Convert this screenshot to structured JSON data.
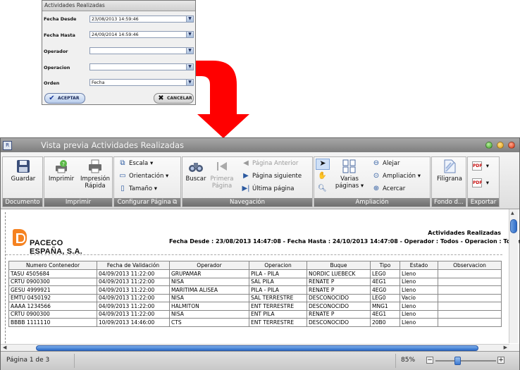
{
  "dialog": {
    "title": "Actividades Realizadas",
    "fields": [
      {
        "label": "Fecha Desde",
        "value": "23/08/2013 14:59:46"
      },
      {
        "label": "Fecha Hasta",
        "value": "24/09/2014 14:59:46"
      },
      {
        "label": "Operador",
        "value": ""
      },
      {
        "label": "Operacion",
        "value": ""
      },
      {
        "label": "Orden",
        "value": "Fecha"
      }
    ],
    "ok_label": "ACEPTAR",
    "cancel_label": "CANCELAR"
  },
  "window": {
    "title": "Vista previa Actividades Realizadas",
    "ribbon": {
      "documento": {
        "group": "Documento",
        "guardar": "Guardar"
      },
      "imprimir": {
        "group": "Imprimir",
        "imprimir": "Imprimir",
        "impresion_rapida_1": "Impresión",
        "impresion_rapida_2": "Rápida"
      },
      "configurar": {
        "group": "Configurar Página",
        "escala": "Escala",
        "orientacion": "Orientación",
        "tamano": "Tamaño"
      },
      "navegacion": {
        "group": "Navegación",
        "buscar": "Buscar",
        "primera_1": "Primera",
        "primera_2": "Página",
        "anterior": "Página Anterior",
        "siguiente": "Página siguiente",
        "ultima": "Última página"
      },
      "ampliacion": {
        "group": "Ampliación",
        "varias_1": "Varias",
        "varias_2": "páginas",
        "alejar": "Alejar",
        "ampliacion": "Ampliación",
        "acercar": "Acercar"
      },
      "fondo": {
        "group": "Fondo d...",
        "filigrana": "Filigrana"
      },
      "exportar": {
        "group": "Exportar"
      }
    },
    "report": {
      "company": "PACECO ESPAÑA, S.A.",
      "title": "Actividades Realizadas",
      "filter_line": "Fecha Desde : 23/08/2013 14:47:08 - Fecha Hasta : 24/10/2013 14:47:08 - Operador : Todos - Operacion : Todos",
      "columns": [
        "Numero Contenedor",
        "Fecha de Validación",
        "Operador",
        "Operacion",
        "Buque",
        "Tipo",
        "Estado",
        "Observacion"
      ],
      "rows": [
        [
          "TASU 4505684",
          "04/09/2013 11:22:00",
          "GRUPAMAR",
          "PILA - PILA",
          "NORDIC LUEBECK",
          "LEG0",
          "Lleno",
          ""
        ],
        [
          "CRTU 0900300",
          "04/09/2013 11:22:00",
          "NISA",
          "SAL PILA",
          "RENATE P",
          "4EG1",
          "Lleno",
          ""
        ],
        [
          "GESU 4999921",
          "04/09/2013 11:22:00",
          "MARITIMA ALISEA",
          "PILA - PILA",
          "RENATE P",
          "4EG0",
          "Lleno",
          ""
        ],
        [
          "EMTU 0450192",
          "04/09/2013 11:22:00",
          "NISA",
          "SAL TERRESTRE",
          "DESCONOCIDO",
          "LEG0",
          "Vacio",
          ""
        ],
        [
          "AAAA 1234566",
          "04/09/2013 11:22:00",
          "HALMITON",
          "ENT TERRESTRE",
          "DESCONOCIDO",
          "MNG1",
          "Lleno",
          ""
        ],
        [
          "CRTU 0900300",
          "04/09/2013 11:22:00",
          "NISA",
          "ENT PILA",
          "RENATE P",
          "4EG1",
          "Lleno",
          ""
        ],
        [
          "BBBB 1111110",
          "10/09/2013 14:46:00",
          "CTS",
          "ENT TERRESTRE",
          "DESCONOCIDO",
          "20B0",
          "Lleno",
          ""
        ]
      ]
    },
    "status": {
      "page": "Página 1 de 3",
      "zoom": "85%",
      "zoom_fraction": 0.36
    }
  }
}
